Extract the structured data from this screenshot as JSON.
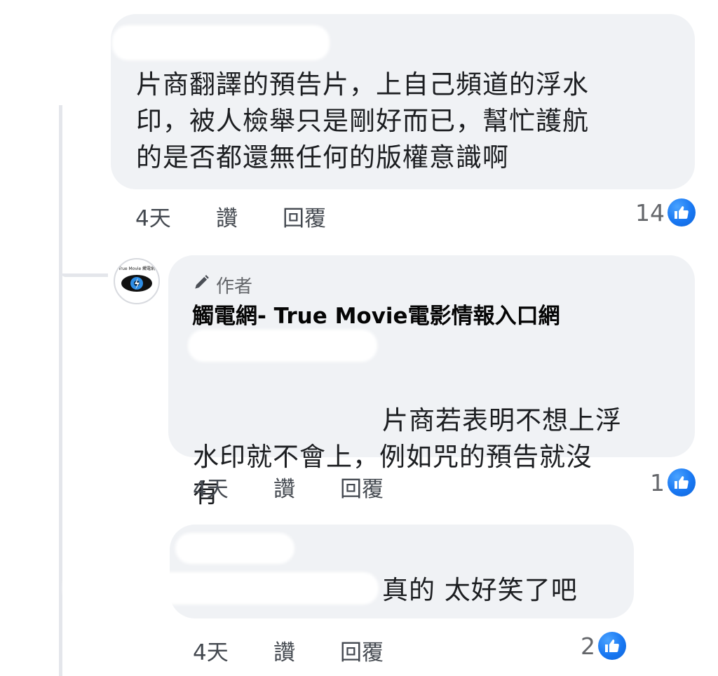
{
  "comments": [
    {
      "text": "片商翻譯的預告片，上自己頻道的浮水\n印，被人檢舉只是剛好而已，幫忙護航\n的是否都還無任何的版權意識啊",
      "time": "4天",
      "like_label": "讚",
      "reply_label": "回覆",
      "reaction_count": "14"
    },
    {
      "author_badge": "作者",
      "author_name": "觸電網- True Movie電影情報入口網",
      "avatar_text": "True Movie 觸電網",
      "text": "片商若表明不想上浮\n水印就不會上，例如咒的預告就沒\n有",
      "time": "4天",
      "like_label": "讚",
      "reply_label": "回覆",
      "reaction_count": "1"
    },
    {
      "text": "真的 太好笑了吧",
      "time": "4天",
      "like_label": "讚",
      "reply_label": "回覆",
      "reaction_count": "2"
    }
  ],
  "colors": {
    "bubble": "#f0f2f5",
    "like_blue": "#1877f2",
    "thread_line": "#e4e6eb"
  },
  "icons": {
    "reaction": "thumbs-up-icon",
    "author_badge": "pen-icon"
  }
}
